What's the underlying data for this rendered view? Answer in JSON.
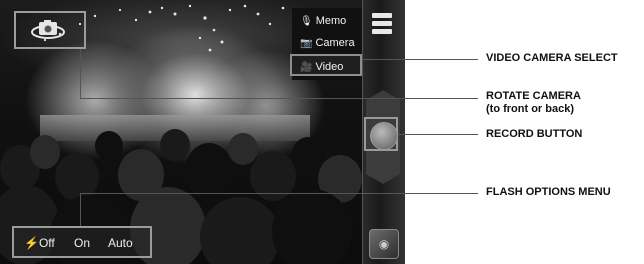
{
  "camera_modes": [
    {
      "icon": "microphone-icon",
      "label": "Memo",
      "selected": false
    },
    {
      "icon": "camera-icon",
      "label": "Camera",
      "selected": false
    },
    {
      "icon": "video-camera-icon",
      "label": "Video",
      "selected": true
    }
  ],
  "flash": {
    "options": [
      "Off",
      "On",
      "Auto"
    ]
  },
  "callouts": {
    "video_camera_select": "VIDEO CAMERA SELECT",
    "rotate_camera": "ROTATE CAMERA",
    "rotate_camera_sub": "(to front or back)",
    "record_button": "RECORD BUTTON",
    "flash_options_menu": "FLASH OPTIONS MENU"
  },
  "icons": {
    "menu": "hamburger-menu-icon",
    "rotate": "camera-rotate-icon",
    "flash": "lightning-bolt-icon",
    "record": "record-button-icon",
    "thumbnail": "last-photo-thumbnail-icon"
  }
}
